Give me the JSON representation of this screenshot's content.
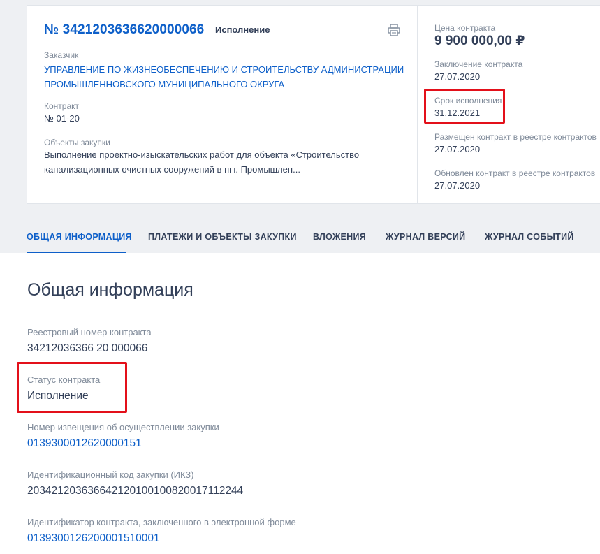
{
  "header": {
    "contract_number": "№ 3421203636620000066",
    "status": "Исполнение",
    "customer_label": "Заказчик",
    "customer_name": "УПРАВЛЕНИЕ ПО ЖИЗНЕОБЕСПЕЧЕНИЮ И СТРОИТЕЛЬСТВУ АДМИНИСТРАЦИИ ПРОМЫШЛЕННОВСКОГО МУНИЦИПАЛЬНОГО ОКРУГА",
    "contract_label": "Контракт",
    "contract_value": "№ 01-20",
    "objects_label": "Объекты закупки",
    "objects_value": "Выполнение проектно-изыскательских работ для объекта «Строительство канализационных очистных сооружений в пгт. Промышлен..."
  },
  "sidebar": {
    "price_label": "Цена контракта",
    "price_value": "9 900 000,00 ₽",
    "conclusion_label": "Заключение контракта",
    "conclusion_value": "27.07.2020",
    "deadline_label": "Срок исполнения",
    "deadline_value": "31.12.2021",
    "placed_label": "Размещен контракт в реестре контрактов",
    "placed_value": "27.07.2020",
    "updated_label": "Обновлен контракт в реестре контрактов",
    "updated_value": "27.07.2020"
  },
  "tabs": [
    {
      "label": "ОБЩАЯ ИНФОРМАЦИЯ",
      "active": true
    },
    {
      "label": "ПЛАТЕЖИ И ОБЪЕКТЫ ЗАКУПКИ",
      "active": false
    },
    {
      "label": "ВЛОЖЕНИЯ",
      "active": false
    },
    {
      "label": "ЖУРНАЛ ВЕРСИЙ",
      "active": false
    },
    {
      "label": "ЖУРНАЛ СОБЫТИЙ",
      "active": false
    }
  ],
  "main": {
    "title": "Общая информация",
    "fields": [
      {
        "label": "Реестровый номер контракта",
        "value": "34212036366 20 000066"
      },
      {
        "label": "Статус контракта",
        "value": "Исполнение"
      },
      {
        "label": "Номер извещения об осуществлении закупки",
        "value": "0139300012620000151"
      },
      {
        "label": "Идентификационный код закупки (ИКЗ)",
        "value": "203421203636642120100100820017112244"
      },
      {
        "label": "Идентификатор контракта, заключенного в электронной форме",
        "value": "0139300126200001510001"
      }
    ]
  },
  "icons": {
    "print": "print-icon"
  },
  "colors": {
    "accent": "#0d5fc9",
    "text": "#334059",
    "muted": "#7f8a99",
    "highlight": "#e3101a",
    "band": "#eef0f3"
  }
}
